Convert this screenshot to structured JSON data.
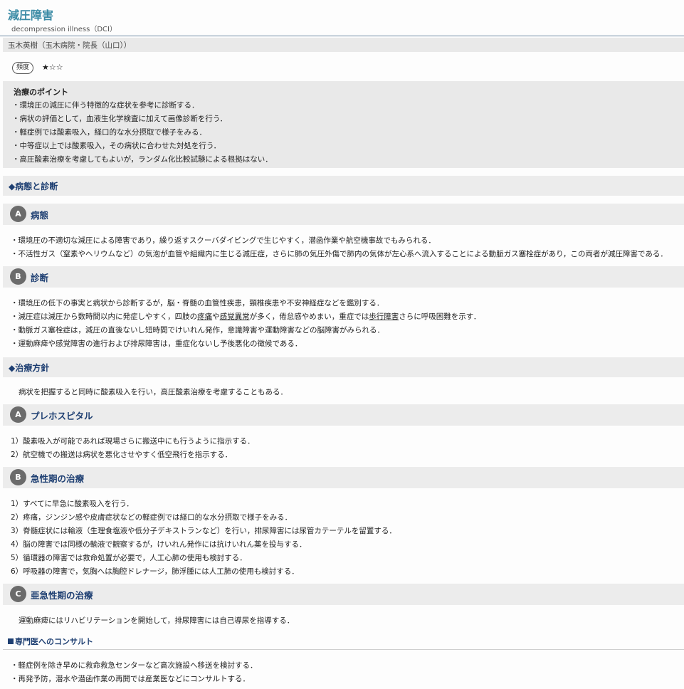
{
  "header": {
    "title": "減圧障害",
    "subtitle": "decompression illness（DCI）",
    "author": "玉木英樹（玉木病院・院長（山口））"
  },
  "frequency": {
    "badge": "頻度",
    "stars": "★☆☆"
  },
  "points": {
    "heading": "治療のポイント",
    "items": [
      "・環境圧の減圧に伴う特徴的な症状を参考に診断する．",
      "・病状の評価として，血液生化学検査に加えて画像診断を行う．",
      "・軽症例では酸素吸入，経口的な水分摂取で様子をみる．",
      "・中等症以上では酸素吸入，その病状に合わせた対処を行う．",
      "・高圧酸素治療を考慮してもよいが，ランダム化比較試験による根拠はない．"
    ]
  },
  "sections": {
    "pathology_diagnosis": "◆病態と診断",
    "treatment_policy": "◆治療方針"
  },
  "pathology": {
    "letter": "A",
    "title": "病態",
    "items": [
      "・環境圧の不適切な減圧による障害であり，繰り返すスクーバダイビングで生じやすく，潜函作業や航空機事故でもみられる．",
      "・不活性ガス（窒素やヘリウムなど）の気泡が血管や組織内に生じる減圧症，さらに肺の気圧外傷で肺内の気体が左心系へ流入することによる動脈ガス塞栓症があり，この両者が減圧障害である．"
    ]
  },
  "diagnosis": {
    "letter": "B",
    "title": "診断",
    "line1": "・環境圧の低下の事実と病状から診断するが，脳・脊髄の血管性疾患，頸椎疾患や不安神経症などを鑑別する．",
    "line2_a": "・減圧症は減圧から数時間以内に発症しやすく，四肢の",
    "line2_u1": "疼痛",
    "line2_b": "や",
    "line2_u2": "感覚異常",
    "line2_c": "が多く，倦怠感やめまい，重症では",
    "line2_u3": "歩行障害",
    "line2_d": "さらに呼吸困難を示す．",
    "line3": "・動脈ガス塞栓症は，減圧の直後ないし短時間でけいれん発作，意識障害や運動障害などの脳障害がみられる．",
    "line4": "・運動麻痺や感覚障害の進行および排尿障害は，重症化ないし予後悪化の徴候である．"
  },
  "treatment_intro": "病状を把握すると同時に酸素吸入を行い，高圧酸素治療を考慮することもある．",
  "prehospital": {
    "letter": "A",
    "title": "プレホスピタル",
    "items": [
      "1）酸素吸入が可能であれば現場さらに搬送中にも行うように指示する．",
      "2）航空機での搬送は病状を悪化させやすく低空飛行を指示する．"
    ]
  },
  "acute": {
    "letter": "B",
    "title": "急性期の治療",
    "items": [
      "1）すべてに早急に酸素吸入を行う．",
      "2）疼痛，ジンジン感や皮膚症状などの軽症例では経口的な水分摂取で様子をみる．",
      "3）脊髄症状には輸液（生理食塩液や低分子デキストランなど）を行い，排尿障害には尿管カテーテルを留置する．",
      "4）脳の障害では同様の輸液で観察するが，けいれん発作には抗けいれん薬を投与する．",
      "5）循環器の障害では救命処置が必要で，人工心肺の使用も検討する．",
      "6）呼吸器の障害で，気胸へは胸腔ドレナージ，肺浮腫には人工肺の使用も検討する．"
    ]
  },
  "subacute": {
    "letter": "C",
    "title": "亜急性期の治療",
    "text": "運動麻痺にはリハビリテーションを開始して，排尿障害には自己導尿を指導する．"
  },
  "consult": {
    "heading": "専門医へのコンサルト",
    "items": [
      "・軽症例を除き早めに救命救急センターなど高次施設へ移送を検討する．",
      "・再発予防，潜水や潜函作業の再開では産業医などにコンサルトする．"
    ]
  }
}
